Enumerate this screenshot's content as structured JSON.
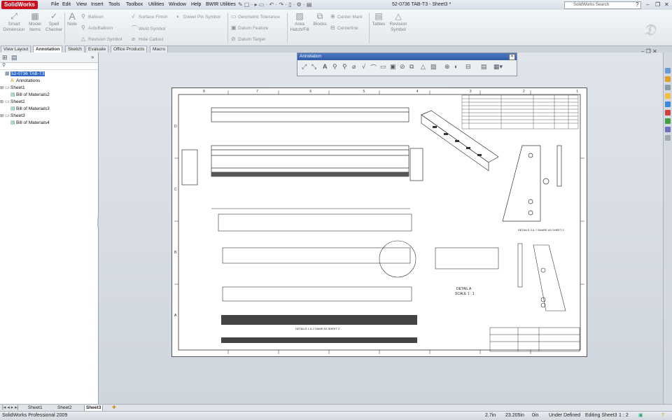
{
  "app": {
    "name": "SolidWorks",
    "document_title": "52-0736 TAB-T3 - Sheet3 *",
    "search_placeholder": "SolidWorks Search",
    "help_label": "?"
  },
  "menus": [
    "File",
    "Edit",
    "View",
    "Insert",
    "Tools",
    "Toolbox",
    "Utilities",
    "Window",
    "Help",
    "BWIR Utilities"
  ],
  "command_manager": {
    "smart_dimension": "Smart Dimension",
    "model_items": "Model Items",
    "spell_checker": "Spell Checker",
    "note": "Note",
    "balloon": "Balloon",
    "autoballoon": "AutoBalloon",
    "revision_symbol_small": "Revision Symbol",
    "surface_finish": "Surface Finish",
    "weld_symbol": "Weld Symbol",
    "hole_callout": "Hole Callout",
    "dowel_pin_symbol": "Dowel Pin Symbol",
    "geometric_tolerance": "Geometric Tolerance",
    "datum_feature": "Datum Feature",
    "datum_target": "Datum Target",
    "area_hatch": "Area Hatch/Fill",
    "blocks": "Blocks",
    "center_mark": "Center Mark",
    "centerline": "Centerline",
    "tables": "Tables",
    "revision_symbol": "Revision Symbol"
  },
  "tabs": [
    "View Layout",
    "Annotation",
    "Sketch",
    "Evaluate",
    "Office Products",
    "Macro"
  ],
  "active_tab": "Annotation",
  "feature_tree": {
    "filter_icon": "filter-icon",
    "items": [
      {
        "label": "52-0736 TAB-T3",
        "level": 0,
        "selected": true
      },
      {
        "label": "Annotations",
        "level": 1
      },
      {
        "label": "Sheet1",
        "level": 0
      },
      {
        "label": "Bill of Materials2",
        "level": 1
      },
      {
        "label": "Sheet2",
        "level": 0
      },
      {
        "label": "Bill of Materials3",
        "level": 1
      },
      {
        "label": "Sheet3",
        "level": 0
      },
      {
        "label": "Bill of Materials4",
        "level": 1
      }
    ]
  },
  "annotation_toolbar": {
    "title": "Annotation",
    "close": "×"
  },
  "drawing": {
    "zone_numbers_top": [
      "8",
      "7",
      "6",
      "5",
      "4",
      "3",
      "2",
      "1"
    ],
    "zone_letters": [
      "D",
      "C",
      "B",
      "A"
    ],
    "detail_label": "DETAIL A",
    "detail_scale": "SCALE 1 : 1",
    "details_note_1": "DETAILS 3 & 7 SHARE AS SHEET 2",
    "details_note_2": "DETAILS 1 & 2 SAME AS SHEET 2"
  },
  "sheet_tabs": [
    "Sheet1",
    "Sheet2",
    "Sheet3"
  ],
  "active_sheet": "Sheet3",
  "status": {
    "product": "SolidWorks Professional 2009",
    "x": "2.7in",
    "y": "23.205in",
    "z": "0in",
    "state": "Under Defined",
    "editing": "Editing Sheet3",
    "scale": "1 : 2"
  }
}
